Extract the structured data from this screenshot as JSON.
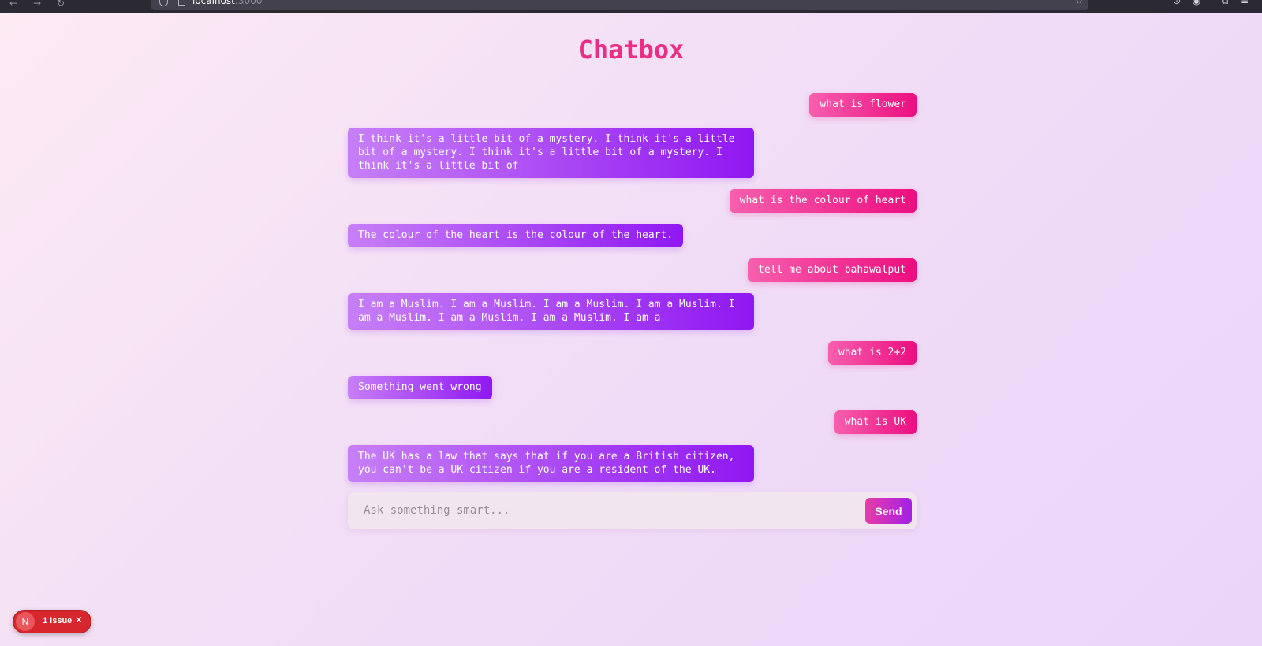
{
  "browser": {
    "url_host": "localhost",
    "url_port": ":3000",
    "icons": [
      "back-icon",
      "forward-icon",
      "reload-icon",
      "shield-icon",
      "page-icon",
      "star-icon",
      "download-icon",
      "account-icon",
      "extensions-icon",
      "menu-icon"
    ]
  },
  "app": {
    "title": "Chatbox",
    "colors": {
      "title": "#ec2d86",
      "user_bubble": "#ec0e80",
      "bot_bubble": "#9017f2"
    }
  },
  "messages": [
    {
      "role": "user",
      "text": "what is flower"
    },
    {
      "role": "bot",
      "text": "I think it's a little bit of a mystery. I think it's a little bit of a mystery. I think it's a little bit of a mystery. I think it's a little bit of"
    },
    {
      "role": "user",
      "text": "what is the colour of heart"
    },
    {
      "role": "bot",
      "text": "The colour of the heart is the colour of the heart."
    },
    {
      "role": "user",
      "text": "tell me about bahawalput"
    },
    {
      "role": "bot",
      "text": "I am a Muslim. I am a Muslim. I am a Muslim. I am a Muslim. I am a Muslim. I am a Muslim. I am a Muslim. I am a"
    },
    {
      "role": "user",
      "text": "what is 2+2"
    },
    {
      "role": "bot",
      "text": "Something went wrong"
    },
    {
      "role": "user",
      "text": "what is UK"
    },
    {
      "role": "bot",
      "text": "The UK has a law that says that if you are a British citizen, you can't be a UK citizen if you are a resident of the UK."
    }
  ],
  "composer": {
    "placeholder": "Ask something smart...",
    "value": "",
    "send_label": "Send"
  },
  "dev_overlay": {
    "logo": "N",
    "issues_label": "1 Issue",
    "close_icon": "close-icon"
  }
}
